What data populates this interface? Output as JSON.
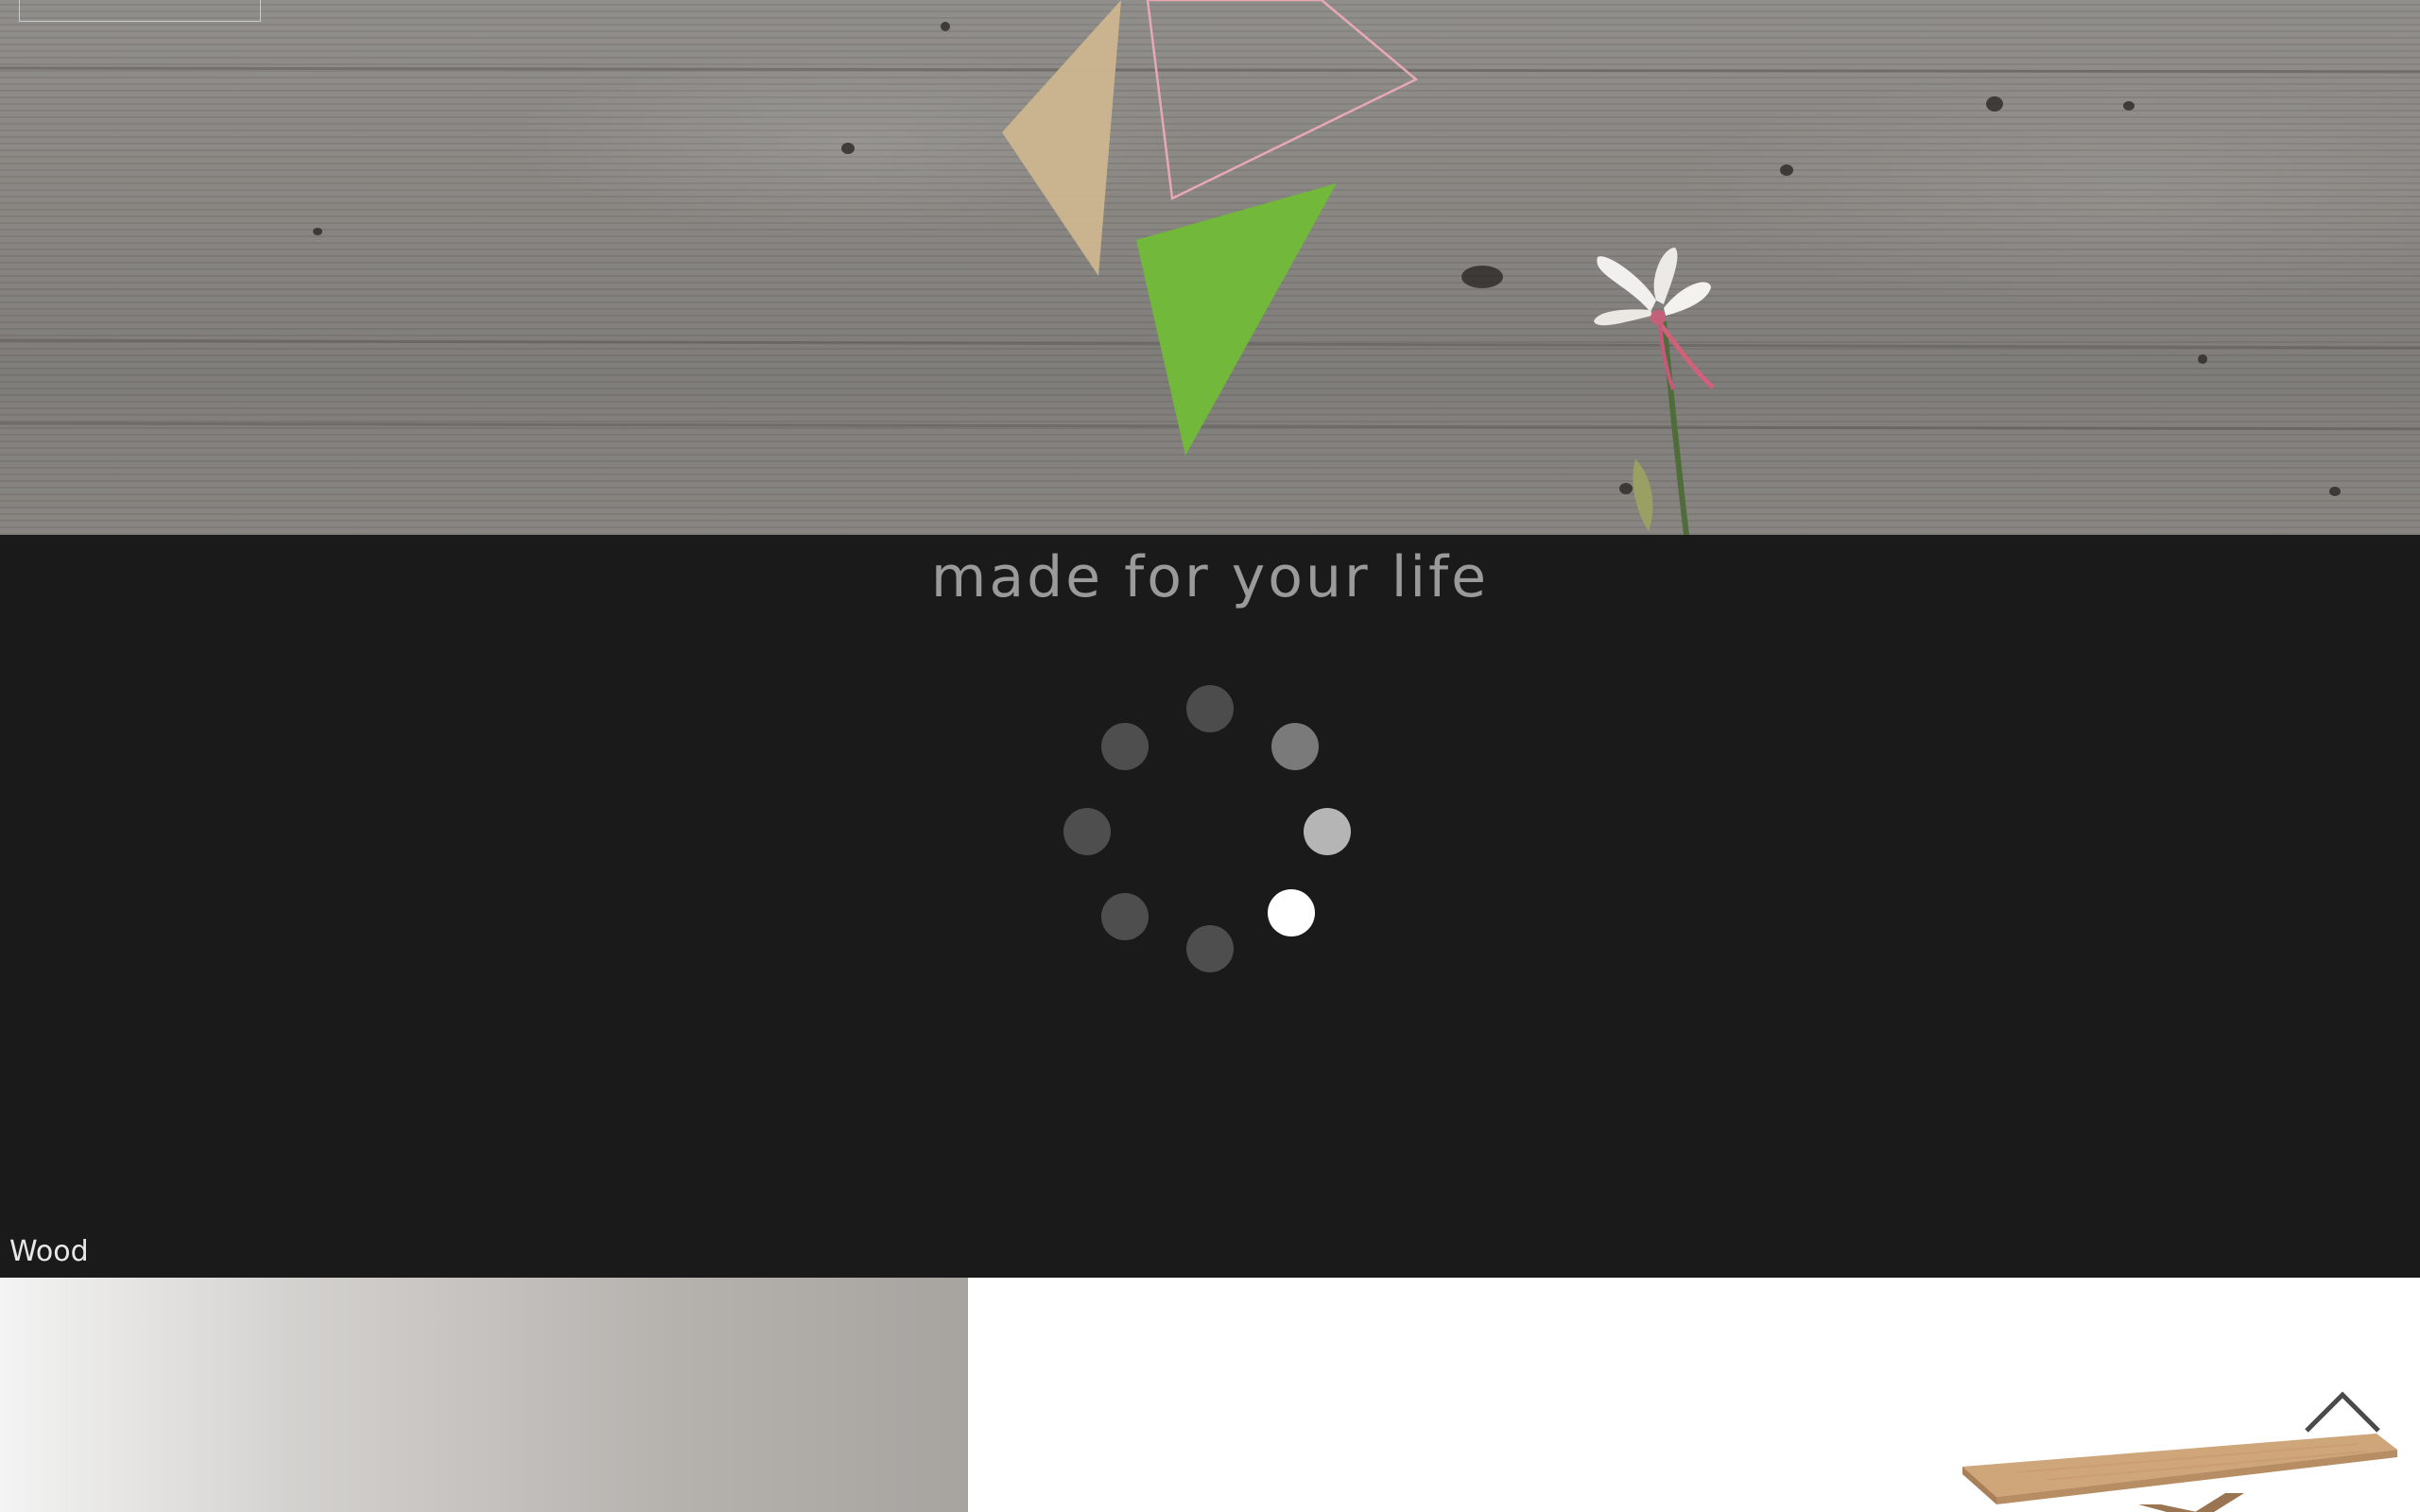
{
  "hero": {
    "image": "concrete-wall-with-flower"
  },
  "tagline": "made for your life",
  "loader": {
    "dots": 8,
    "active_color": "#ffffff",
    "inactive_color": "#4e4e4e"
  },
  "category": {
    "label": "Wood"
  },
  "colors": {
    "background": "#1a1a1a",
    "tagline": "#9a9a9a",
    "triangle_tan": "#cdb58f",
    "triangle_green": "#72b83a",
    "triangle_pink_outline": "#e7a8b4"
  },
  "icons": {
    "scroll_top": "chevron-up-icon"
  }
}
